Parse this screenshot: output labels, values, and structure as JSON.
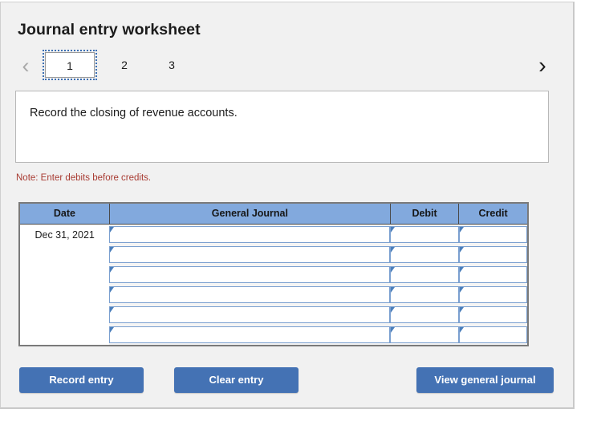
{
  "panel": {
    "title": "Journal entry worksheet"
  },
  "pager": {
    "prev_icon": "chevron-left-icon",
    "next_icon": "chevron-right-icon",
    "prev_glyph": "‹",
    "next_glyph": "›",
    "tabs": [
      {
        "label": "1",
        "active": true
      },
      {
        "label": "2",
        "active": false
      },
      {
        "label": "3",
        "active": false
      }
    ]
  },
  "description": {
    "text": "Record the closing of revenue accounts."
  },
  "note": {
    "text": "Note: Enter debits before credits."
  },
  "table": {
    "headers": [
      "Date",
      "General Journal",
      "Debit",
      "Credit"
    ],
    "rows": [
      {
        "date": "Dec 31, 2021",
        "general_journal": "",
        "debit": "",
        "credit": ""
      },
      {
        "date": "",
        "general_journal": "",
        "debit": "",
        "credit": ""
      },
      {
        "date": "",
        "general_journal": "",
        "debit": "",
        "credit": ""
      },
      {
        "date": "",
        "general_journal": "",
        "debit": "",
        "credit": ""
      },
      {
        "date": "",
        "general_journal": "",
        "debit": "",
        "credit": ""
      },
      {
        "date": "",
        "general_journal": "",
        "debit": "",
        "credit": ""
      }
    ]
  },
  "buttons": {
    "record": "Record entry",
    "clear": "Clear entry",
    "view": "View general journal"
  },
  "colors": {
    "header_blue": "#82a9dd",
    "button_blue": "#4472b4",
    "note_red": "#a83b32",
    "panel_bg": "#f1f1f1",
    "cell_border_blue": "#7ba0d0",
    "focus_outline_blue": "#3c6fb4"
  }
}
